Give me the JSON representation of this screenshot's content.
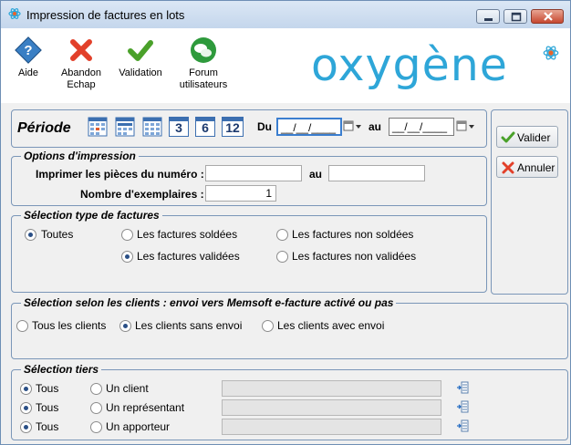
{
  "window": {
    "title": "Impression de factures en lots"
  },
  "toolbar": {
    "help": "Aide",
    "cancel_l1": "Abandon",
    "cancel_l2": "Echap",
    "validate": "Validation",
    "forum_l1": "Forum",
    "forum_l2": "utilisateurs",
    "logo": "oxygène"
  },
  "periode": {
    "label": "Période",
    "cal3": "3",
    "cal6": "6",
    "cal12": "12",
    "du_label": "Du",
    "du_value": "__/__/____",
    "au_label": "au",
    "au_value": "__/__/____"
  },
  "actions": {
    "valider": "Valider",
    "annuler": "Annuler"
  },
  "options": {
    "legend": "Options d'impression",
    "pieces_label": "Imprimer les pièces du numéro :",
    "pieces_from": "",
    "au_label": "au",
    "pieces_to": "",
    "copies_label": "Nombre d'exemplaires :",
    "copies_value": "1"
  },
  "types": {
    "legend": "Sélection type de factures",
    "all": "Toutes",
    "paid": "Les factures soldées",
    "unpaid": "Les factures non soldées",
    "validated": "Les factures validées",
    "not_validated": "Les factures non validées"
  },
  "clients": {
    "legend": "Sélection selon les clients : envoi vers Memsoft e-facture activé ou pas",
    "all": "Tous les clients",
    "without": "Les clients sans envoi",
    "with": "Les clients avec envoi"
  },
  "tiers": {
    "legend": "Sélection tiers",
    "rows": [
      {
        "all": "Tous",
        "single": "Un client",
        "value": ""
      },
      {
        "all": "Tous",
        "single": "Un représentant",
        "value": ""
      },
      {
        "all": "Tous",
        "single": "Un apporteur",
        "value": ""
      }
    ]
  }
}
